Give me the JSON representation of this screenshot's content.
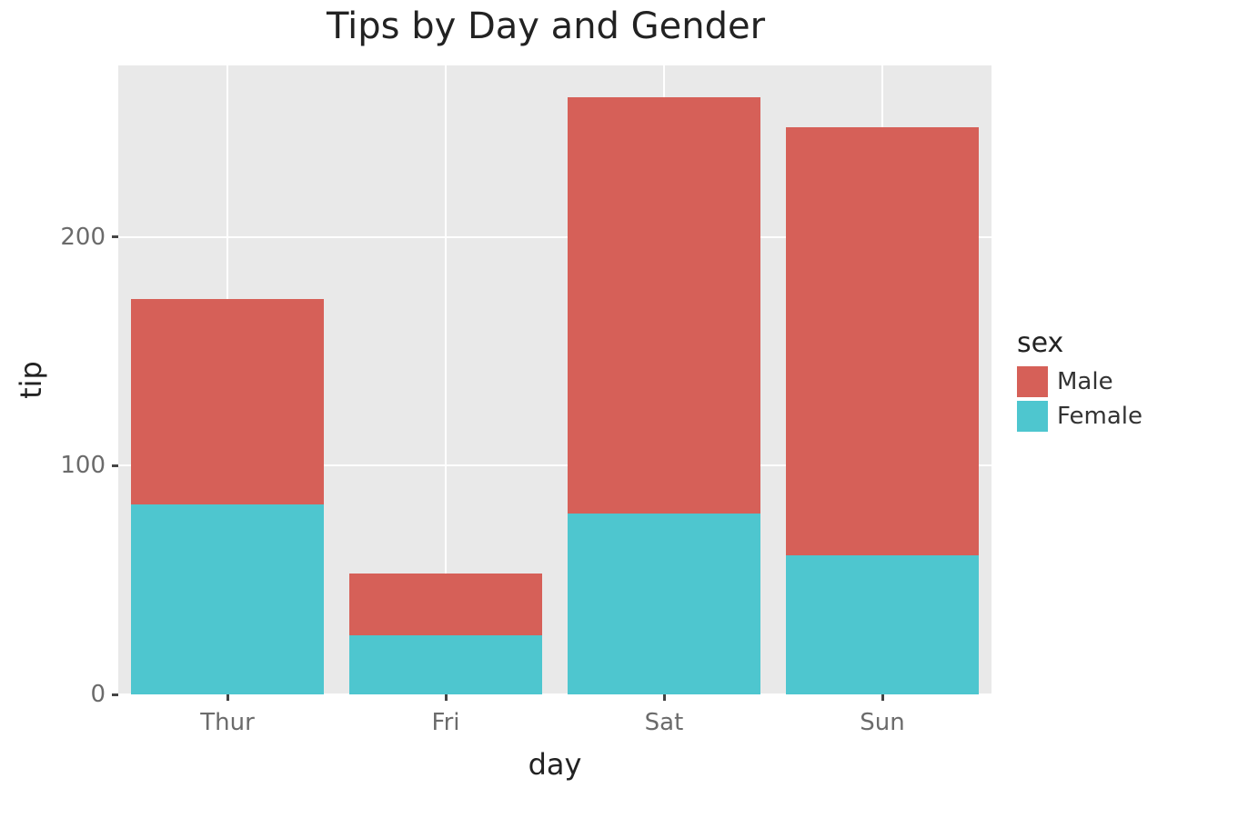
{
  "chart_data": {
    "type": "bar",
    "stacked": true,
    "title": "Tips by Day and Gender",
    "xlabel": "day",
    "ylabel": "tip",
    "categories": [
      "Thur",
      "Fri",
      "Sat",
      "Sun"
    ],
    "series": [
      {
        "name": "Male",
        "color": "#d66058",
        "values": [
          90,
          27,
          182,
          187
        ]
      },
      {
        "name": "Female",
        "color": "#4ec6cf",
        "values": [
          83,
          26,
          79,
          61
        ]
      }
    ],
    "y_ticks": [
      0,
      100,
      200
    ],
    "ylim": [
      0,
      275
    ],
    "legend_title": "sex",
    "legend_position": "right",
    "grid": true
  }
}
